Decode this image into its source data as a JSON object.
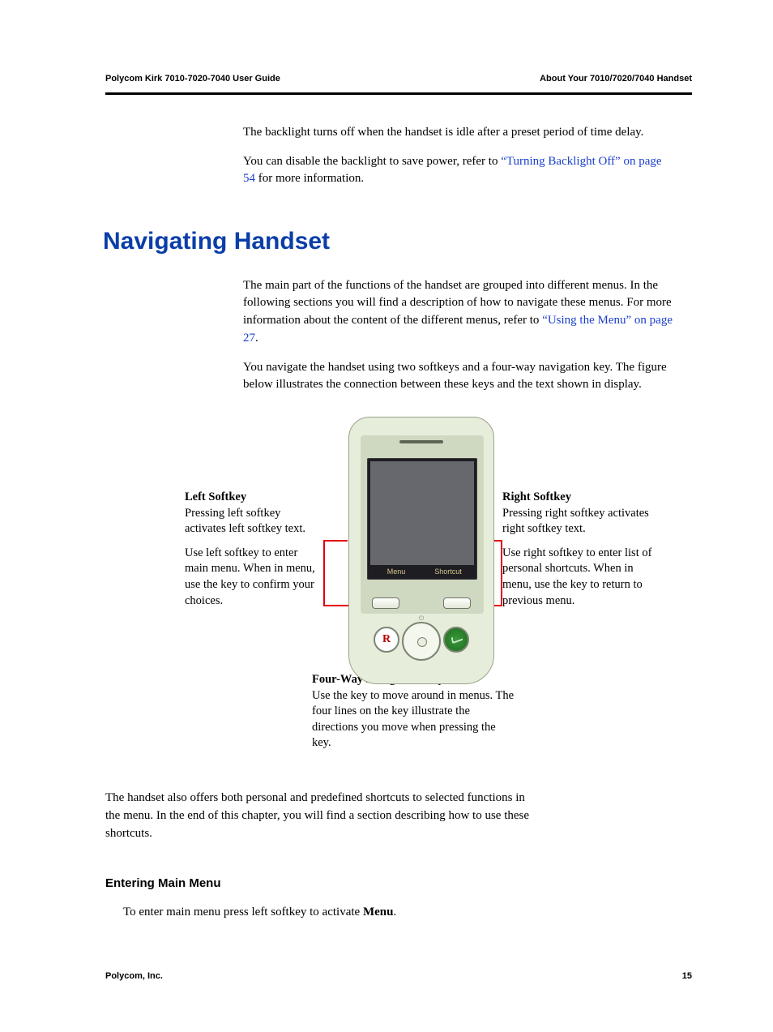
{
  "header": {
    "left": "Polycom Kirk 7010-7020-7040 User Guide",
    "right": "About Your 7010/7020/7040 Handset"
  },
  "intro": {
    "p1": "The backlight turns off when the handset is idle after a preset period of time delay.",
    "p2a": "You can disable the backlight to save power, refer to ",
    "p2link": "“Turning Backlight Off” on page 54",
    "p2b": " for more information."
  },
  "section_title": "Navigating Handset",
  "nav": {
    "p1a": "The main part of the functions of the handset are grouped into different menus. In the following sections you will find a description of how to navigate these menus. For more information about the content of the different menus, refer to ",
    "p1link": "“Using the Menu” on page 27",
    "p1b": ".",
    "p2": "You navigate the handset using two softkeys and a four-way navigation key. The figure below illustrates the connection between these keys and the text shown in display."
  },
  "callouts": {
    "left_title": "Left Softkey",
    "left_p1": "Pressing left softkey activates left softkey text.",
    "left_p2": "Use left softkey to enter main menu. When in menu, use the key to confirm your choices.",
    "right_title": "Right Softkey",
    "right_p1": "Pressing right softkey activates right softkey text.",
    "right_p2": "Use right softkey to enter list of personal shortcuts. When in menu, use the key to return to previous menu.",
    "bottom_title": "Four-Way Navigation Key",
    "bottom_p": "Use the key to move around in menus. The four lines on the key illustrate the directions you move when pressing the key."
  },
  "phone_screen": {
    "left_soft": "Menu",
    "right_soft": "Shortcut",
    "r_label": "R"
  },
  "after_diagram": "The handset also offers both personal and predefined shortcuts to selected functions in the menu. In the end of this chapter, you will find a section describing how to use these shortcuts.",
  "subsection": {
    "title": "Entering Main Menu",
    "step_a": "To enter main menu press left softkey to activate ",
    "step_bold": "Menu",
    "step_b": "."
  },
  "footer": {
    "left": "Polycom, Inc.",
    "right": "15"
  }
}
